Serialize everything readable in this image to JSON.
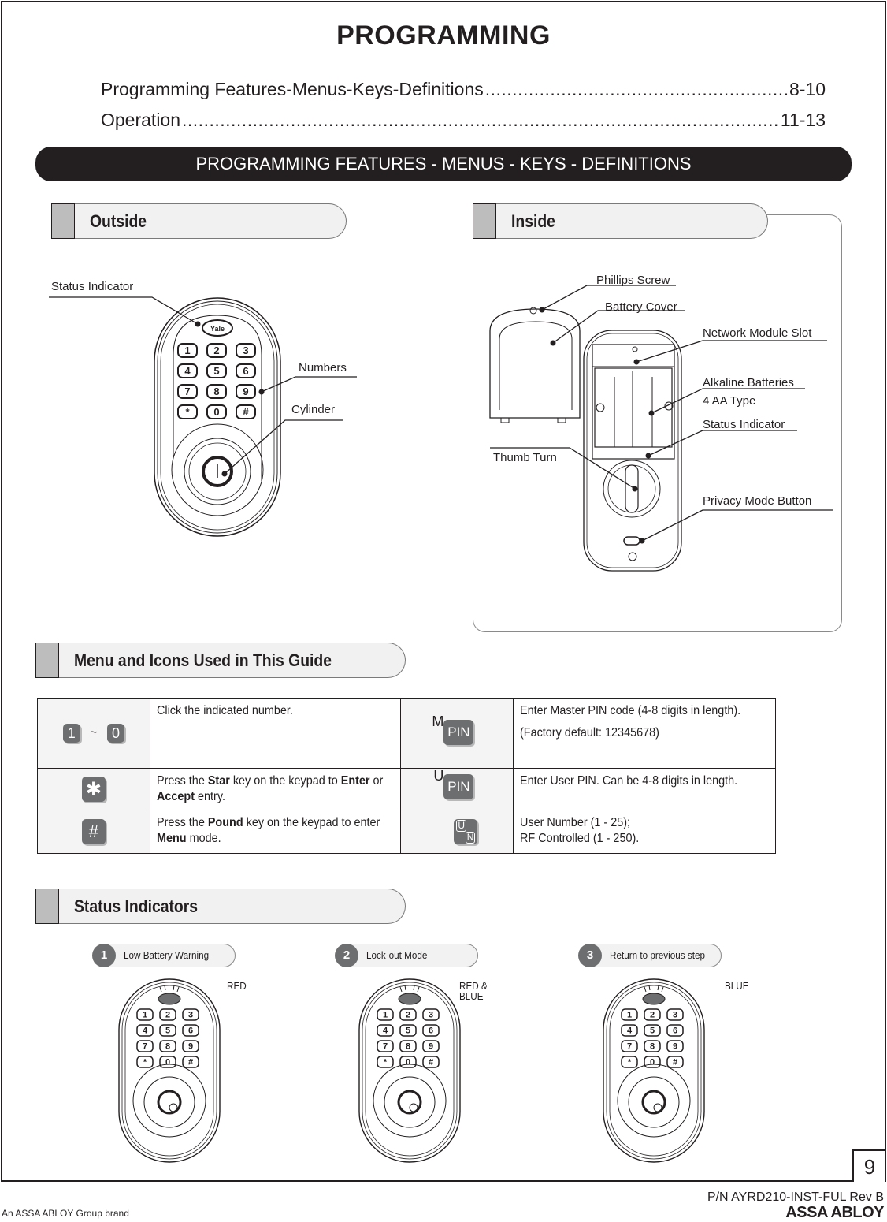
{
  "page_title": "PROGRAMMING",
  "toc": [
    {
      "label": "Programming Features-Menus-Keys-Definitions",
      "pages": "8-10"
    },
    {
      "label": "Operation",
      "pages": "11-13"
    }
  ],
  "banner": "PROGRAMMING FEATURES - MENUS - KEYS - DEFINITIONS",
  "outside": {
    "title": "Outside",
    "callouts": {
      "status_indicator": "Status Indicator",
      "numbers": "Numbers",
      "cylinder": "Cylinder"
    },
    "logo": "Yale",
    "keys": [
      "1",
      "2",
      "3",
      "4",
      "5",
      "6",
      "7",
      "8",
      "9",
      "*",
      "0",
      "#"
    ]
  },
  "inside": {
    "title": "Inside",
    "callouts": {
      "phillips_screw": "Phillips Screw",
      "battery_cover": "Battery Cover",
      "network_module_slot": "Network Module Slot",
      "alkaline_batteries": "Alkaline Batteries",
      "battery_type": "4 AA Type",
      "status_indicator": "Status Indicator",
      "thumb_turn": "Thumb Turn",
      "privacy_mode_button": "Privacy Mode Button"
    }
  },
  "menu_icons": {
    "title": "Menu and Icons Used in This Guide",
    "rows": [
      {
        "left_icon": {
          "key_from": "1",
          "sep": "~",
          "key_to": "0"
        },
        "left_desc": [
          "Click the indicated number."
        ],
        "right_icon": {
          "prefix": "M",
          "label": "PIN"
        },
        "right_desc": [
          "Enter Master PIN code (4-8 digits in length).",
          "(Factory default: 12345678)"
        ]
      },
      {
        "left_icon": {
          "key": "*"
        },
        "left_desc": {
          "t1": "Press the ",
          "b1": "Star",
          "t2": " key on the keypad to ",
          "b2": "Enter",
          "t3": " or ",
          "b3": "Accept",
          "t4": " entry."
        },
        "right_icon": {
          "prefix": "U",
          "label": "PIN"
        },
        "right_desc": [
          "Enter User PIN. Can be 4-8 digits in length."
        ]
      },
      {
        "left_icon": {
          "key": "#"
        },
        "left_desc": {
          "t1": "Press the ",
          "b1": "Pound",
          "t2": " key on the keypad to enter ",
          "b2": "Menu",
          "t3": " mode."
        },
        "right_icon": {
          "top": "U",
          "bottom": "N"
        },
        "right_desc": [
          "User Number (1 - 25);",
          "RF Controlled (1 - 250)."
        ]
      }
    ]
  },
  "status_indicators": {
    "title": "Status Indicators",
    "items": [
      {
        "number": "1",
        "label": "Low Battery Warning",
        "color_text": "RED",
        "color_hex": "#d0021b"
      },
      {
        "number": "2",
        "label": "Lock-out Mode",
        "color_text": "RED & BLUE",
        "color_hex": "#7a3fb0"
      },
      {
        "number": "3",
        "label": "Return to previous step",
        "color_text": "BLUE",
        "color_hex": "#1f5fbf"
      }
    ]
  },
  "page_number": "9",
  "footer": {
    "part_number": "P/N AYRD210-INST-FUL Rev B",
    "group_brand": "An ASSA ABLOY Group brand",
    "logo": "ASSA ABLOY"
  }
}
